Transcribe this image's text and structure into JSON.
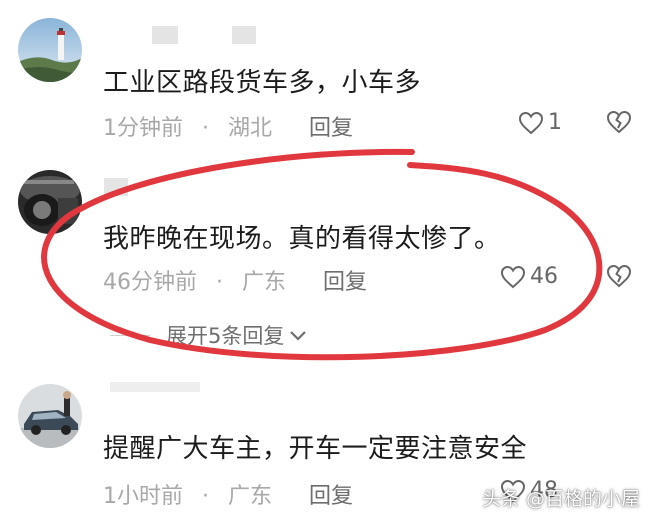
{
  "comments": [
    {
      "text": "工业区路段货车多，小车多",
      "time": "1分钟前",
      "sep": "·",
      "location": "湖北",
      "reply": "回复",
      "likes": "1"
    },
    {
      "text": "我昨晚在现场。真的看得太惨了。",
      "time": "46分钟前",
      "sep": "·",
      "location": "广东",
      "reply": "回复",
      "likes": "46",
      "expand": "展开5条回复"
    },
    {
      "text": "提醒广大车主，开车一定要注意安全",
      "time": "1小时前",
      "sep": "·",
      "location": "广东",
      "reply": "回复",
      "likes": "48"
    }
  ],
  "annotation": {
    "color": "#e0383e",
    "shape": "ellipse"
  },
  "watermark": "头条 @百格的小屋",
  "icons": [
    "heart-outline-icon",
    "broken-heart-icon",
    "chevron-down-icon"
  ]
}
